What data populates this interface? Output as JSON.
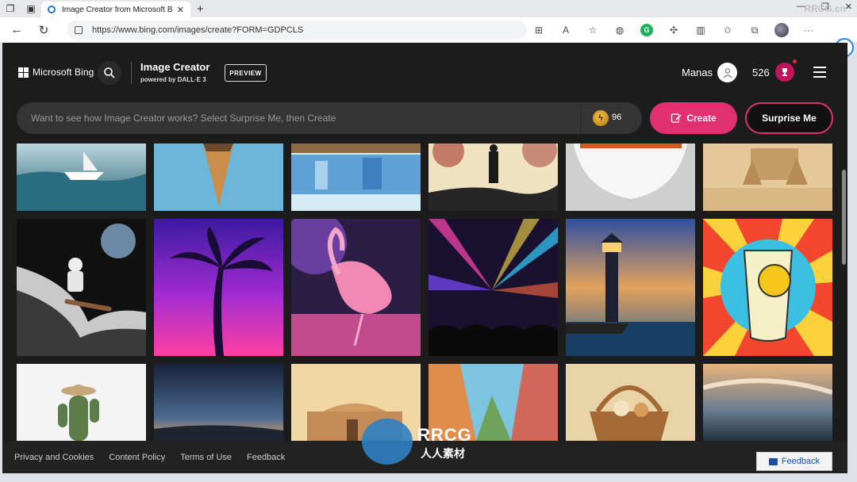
{
  "browser": {
    "tab_title": "Image Creator from Microsoft Bi",
    "url": "https://www.bing.com/images/create?FORM=GDPCLS"
  },
  "header": {
    "brand": "Microsoft Bing",
    "title": "Image Creator",
    "subtitle": "powered by DALL·E 3",
    "preview_badge": "PREVIEW",
    "user_name": "Manas",
    "reward_points": "526"
  },
  "prompt": {
    "placeholder": "Want to see how Image Creator works? Select Surprise Me, then Create",
    "boosts": "96",
    "create_label": "Create",
    "surprise_label": "Surprise Me"
  },
  "footer": {
    "links": [
      "Privacy and Cookies",
      "Content Policy",
      "Terms of Use",
      "Feedback"
    ],
    "feedback_button": "Feedback"
  },
  "watermark": {
    "corner": "RRCG.cn",
    "logo_text": "RRCG",
    "logo_sub": "人人素材"
  },
  "colors": {
    "accent": "#e0306f",
    "background": "#1c1c1c"
  },
  "gallery": {
    "rows": [
      [
        "paper-boat-sea",
        "ice-cream-cone-sky",
        "reflection-water",
        "silhouette-balloons",
        "bowl-closeup",
        "sandcastle"
      ],
      [
        "astronaut-surfing",
        "palm-tree-neon",
        "flamingo-dancing",
        "concert-lasers",
        "lighthouse-sunset",
        "lemonade-pop-art"
      ],
      [
        "cactus-hat",
        "night-sky-horizon",
        "adobe-house",
        "colorful-street",
        "picnic-basket",
        "sunset-sea-clouds"
      ]
    ]
  }
}
